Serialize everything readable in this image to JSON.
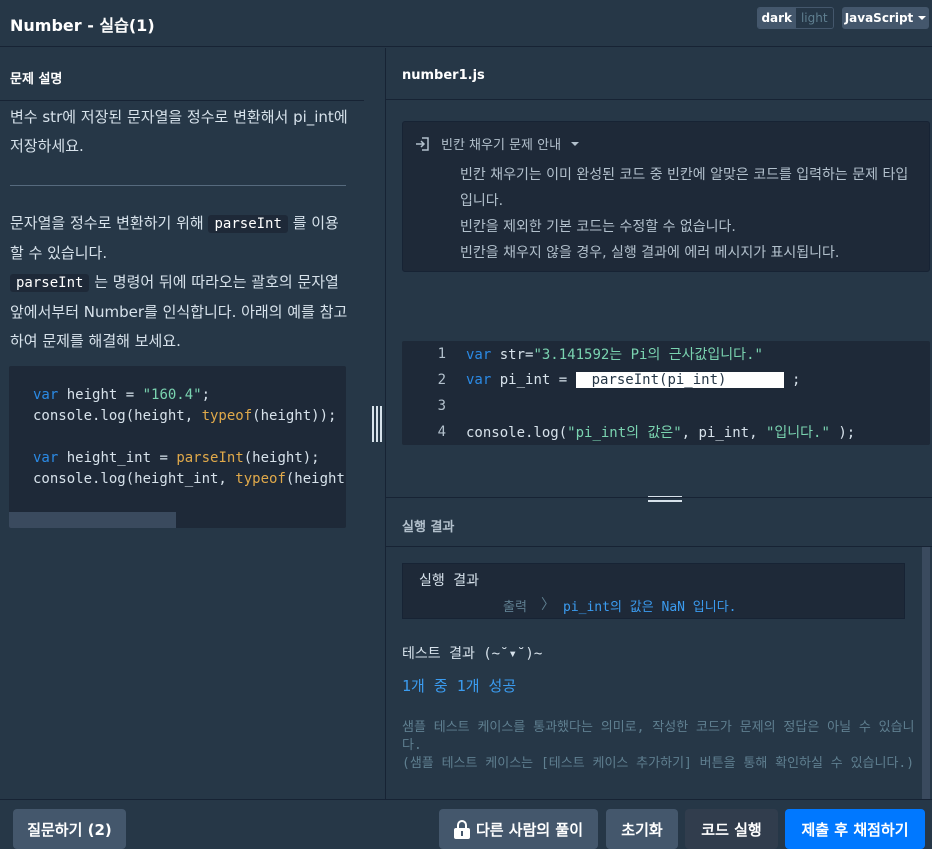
{
  "header": {
    "title": "Number - 실습(1)",
    "theme_dark": "dark",
    "theme_light": "light",
    "language": "JavaScript"
  },
  "problem": {
    "section_title": "문제 설명",
    "paragraph1": "변수 str에 저장된 문자열을 정수로 변환해서 pi_int에 저장하세요.",
    "p2_a": "문자열을 정수로 변환하기 위해 ",
    "p2_code1": "parseInt",
    "p2_b": " 를 이용할 수 있습니다.",
    "p2_code2": "parseInt",
    "p2_c": " 는 명령어 뒤에 따라오는 괄호의 문자열 앞에서부터 Number를 인식합니다. 아래의 예를 참고하여 문제를 해결해 보세요.",
    "example": {
      "l1_kw": "var",
      "l1_rest": " height = ",
      "l1_str": "\"160.4\"",
      "l1_end": ";",
      "l2_a": "console.log(height, ",
      "l2_fn": "typeof",
      "l2_b": "(height));",
      "l4_kw": "var",
      "l4_rest": " height_int = ",
      "l4_fn": "parseInt",
      "l4_b": "(height);",
      "l5_a": "console.log(height_int, ",
      "l5_fn": "typeof",
      "l5_b": "(height"
    }
  },
  "editor": {
    "filename": "number1.js",
    "guide_title": "빈칸 채우기 문제 안내",
    "guide_line1": "빈칸 채우기는 이미 완성된 코드 중 빈칸에 알맞은 코드를 입력하는 문제 타입입니다.",
    "guide_line2": "빈칸을 제외한 기본 코드는 수정할 수 없습니다.",
    "guide_line3": "빈칸을 채우지 않을 경우, 실행 결과에 에러 메시지가 표시됩니다.",
    "lines": [
      {
        "num": "1",
        "kw": "var",
        "a": " str=",
        "str": "\"3.141592는 Pi의 근사값입니다.\""
      },
      {
        "num": "2",
        "kw": "var",
        "a": " pi_int = ",
        "blank": "parseInt(pi_int)",
        "b": " ;"
      },
      {
        "num": "3"
      },
      {
        "num": "4",
        "a": "console.log(",
        "str1": "\"pi_int의 값은\"",
        "b": ", pi_int, ",
        "str2": "\"입니다.\"",
        "c": " );"
      }
    ]
  },
  "result": {
    "tab_label": "실행 결과",
    "box_title": "실행 결과",
    "output_label": "출력",
    "output_sep": "〉",
    "output_value": "pi_int의 값은 NaN 입니다.",
    "test_title": "테스트 결과 (~˘▾˘)~",
    "test_count": "1개 중 1개 성공",
    "note": "샘플 테스트 케이스를 통과했다는 의미로, 작성한 코드가 문제의 정답은 아닐 수 있습니다.\n(샘플 테스트 케이스는 [테스트 케이스 추가하기] 버튼을 통해 확인하실 수 있습니다.)"
  },
  "footer": {
    "ask": "질문하기 (2)",
    "others": "다른 사람의 풀이",
    "reset": "초기화",
    "run": "코드 실행",
    "submit": "제출 후 채점하기"
  }
}
